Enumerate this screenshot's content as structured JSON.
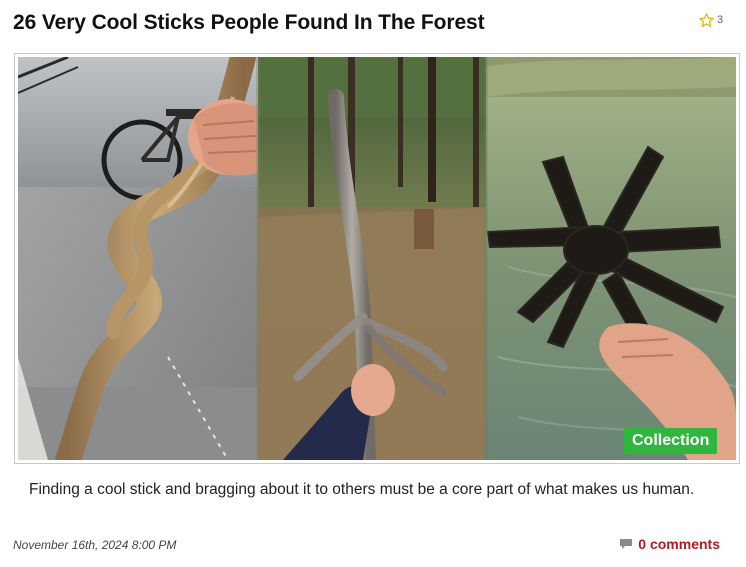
{
  "post": {
    "title": "26 Very Cool Sticks People Found In The Forest",
    "favorite_count": "3",
    "badge_label": "Collection",
    "description": "Finding a cool stick and bragging about it to others must be a core part of what makes us human.",
    "date": "November 16th, 2024 8:00 PM",
    "comments_label": "0 comments"
  },
  "icons": {
    "favorite": "star-outline-icon",
    "comments": "speech-bubble-icon"
  },
  "colors": {
    "title": "#111111",
    "badge_bg": "#2fb63e",
    "badge_text": "#ffffff",
    "comments_link": "#b01c22",
    "star": "#e8b400"
  }
}
